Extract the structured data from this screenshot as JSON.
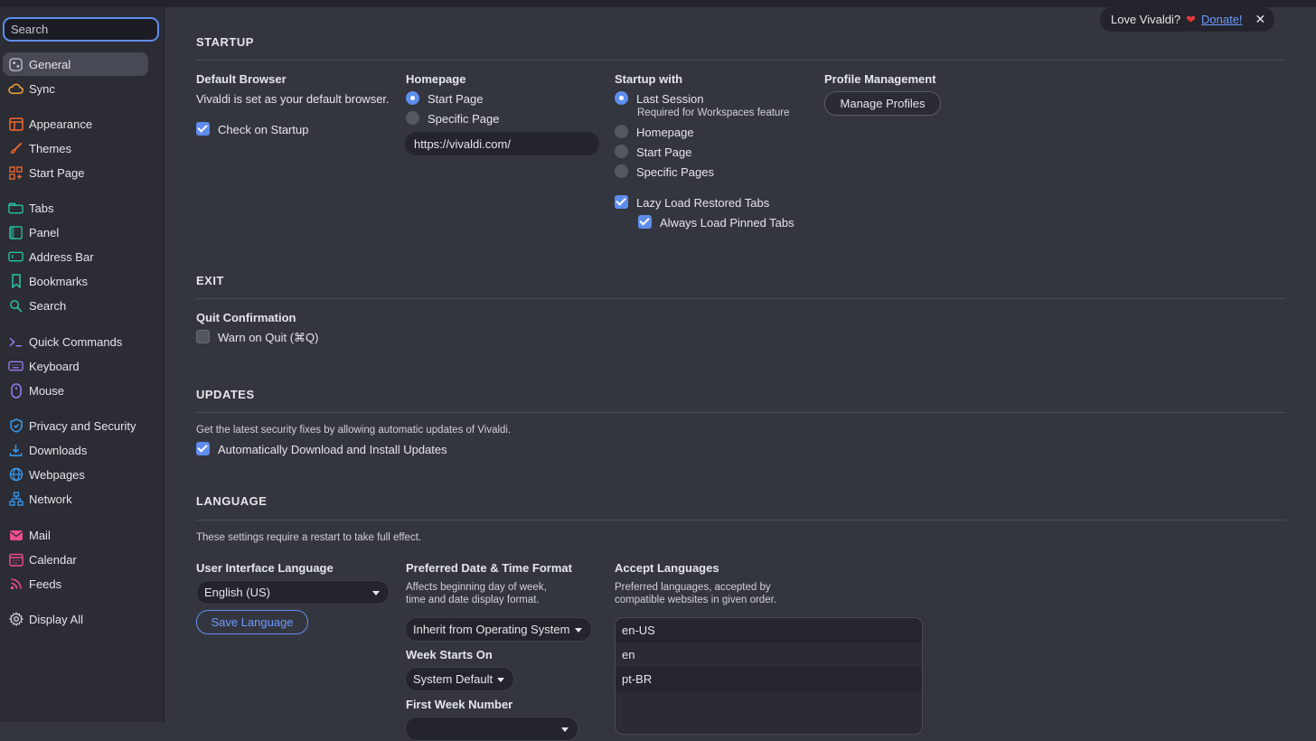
{
  "search": {
    "placeholder": "Search"
  },
  "sidebar": {
    "items": [
      {
        "id": "general",
        "label": "General",
        "icon": "general-icon",
        "color": "#b9bcc6",
        "active": true
      },
      {
        "id": "sync",
        "label": "Sync",
        "icon": "cloud-icon",
        "color": "#f2a23a"
      },
      {
        "id": "appearance",
        "label": "Appearance",
        "icon": "appearance-icon",
        "color": "#f06a2e"
      },
      {
        "id": "themes",
        "label": "Themes",
        "icon": "brush-icon",
        "color": "#f06a2e"
      },
      {
        "id": "start-page",
        "label": "Start Page",
        "icon": "grid-plus-icon",
        "color": "#f06a2e"
      },
      {
        "id": "tabs",
        "label": "Tabs",
        "icon": "tabs-icon",
        "color": "#27c4a4"
      },
      {
        "id": "panel",
        "label": "Panel",
        "icon": "panel-icon",
        "color": "#27c4a4"
      },
      {
        "id": "address-bar",
        "label": "Address Bar",
        "icon": "address-bar-icon",
        "color": "#27c4a4"
      },
      {
        "id": "bookmarks",
        "label": "Bookmarks",
        "icon": "bookmark-icon",
        "color": "#27c4a4"
      },
      {
        "id": "search",
        "label": "Search",
        "icon": "magnifier-icon",
        "color": "#27c4a4"
      },
      {
        "id": "quick-commands",
        "label": "Quick Commands",
        "icon": "quick-commands-icon",
        "color": "#9a7cf0"
      },
      {
        "id": "keyboard",
        "label": "Keyboard",
        "icon": "keyboard-icon",
        "color": "#9a7cf0"
      },
      {
        "id": "mouse",
        "label": "Mouse",
        "icon": "mouse-icon",
        "color": "#9a7cf0"
      },
      {
        "id": "privacy",
        "label": "Privacy and Security",
        "icon": "shield-icon",
        "color": "#3a9df2"
      },
      {
        "id": "downloads",
        "label": "Downloads",
        "icon": "download-icon",
        "color": "#3a9df2"
      },
      {
        "id": "webpages",
        "label": "Webpages",
        "icon": "globe-icon",
        "color": "#3a9df2"
      },
      {
        "id": "network",
        "label": "Network",
        "icon": "network-icon",
        "color": "#3a9df2"
      },
      {
        "id": "mail",
        "label": "Mail",
        "icon": "mail-icon",
        "color": "#f0508a"
      },
      {
        "id": "calendar",
        "label": "Calendar",
        "icon": "calendar-icon",
        "color": "#f0508a"
      },
      {
        "id": "feeds",
        "label": "Feeds",
        "icon": "rss-icon",
        "color": "#f0508a"
      },
      {
        "id": "display-all",
        "label": "Display All",
        "icon": "gear-icon",
        "color": "#d0d1d8"
      }
    ]
  },
  "donate": {
    "text": "Love Vivaldi?",
    "link": "Donate!",
    "close": "✕"
  },
  "startup": {
    "title": "STARTUP",
    "default_browser": {
      "label": "Default Browser",
      "status": "Vivaldi is set as your default browser.",
      "check_on_startup": "Check on Startup"
    },
    "homepage": {
      "label": "Homepage",
      "start_page": "Start Page",
      "specific_page": "Specific Page",
      "url": "https://vivaldi.com/"
    },
    "startup_with": {
      "label": "Startup with",
      "last_session": "Last Session",
      "last_session_note": "Required for Workspaces feature",
      "homepage": "Homepage",
      "start_page": "Start Page",
      "specific_pages": "Specific Pages",
      "lazy_load": "Lazy Load Restored Tabs",
      "always_load_pinned": "Always Load Pinned Tabs"
    },
    "profile": {
      "label": "Profile Management",
      "button": "Manage Profiles"
    }
  },
  "exit": {
    "title": "EXIT",
    "quit_label": "Quit Confirmation",
    "warn_on_quit": "Warn on Quit (⌘Q)"
  },
  "updates": {
    "title": "UPDATES",
    "desc": "Get the latest security fixes by allowing automatic updates of Vivaldi.",
    "auto": "Automatically Download and Install Updates"
  },
  "language": {
    "title": "LANGUAGE",
    "desc": "These settings require a restart to take full effect.",
    "ui_label": "User Interface Language",
    "ui_value": "English (US)",
    "save_button": "Save Language",
    "date_label": "Preferred Date & Time Format",
    "date_desc_1": "Affects beginning day of week,",
    "date_desc_2": "time and date display format.",
    "date_value": "Inherit from Operating System",
    "week_label": "Week Starts On",
    "week_value": "System Default",
    "first_week_label": "First Week Number",
    "accept_label": "Accept Languages",
    "accept_desc_1": "Preferred languages, accepted by",
    "accept_desc_2": "compatible websites in given order.",
    "accept_list": [
      "en-US",
      "en",
      "pt-BR"
    ]
  },
  "colors": {
    "accent": "#5f8dee",
    "bg": "#34363f",
    "sidebar": "#2b2c34"
  }
}
